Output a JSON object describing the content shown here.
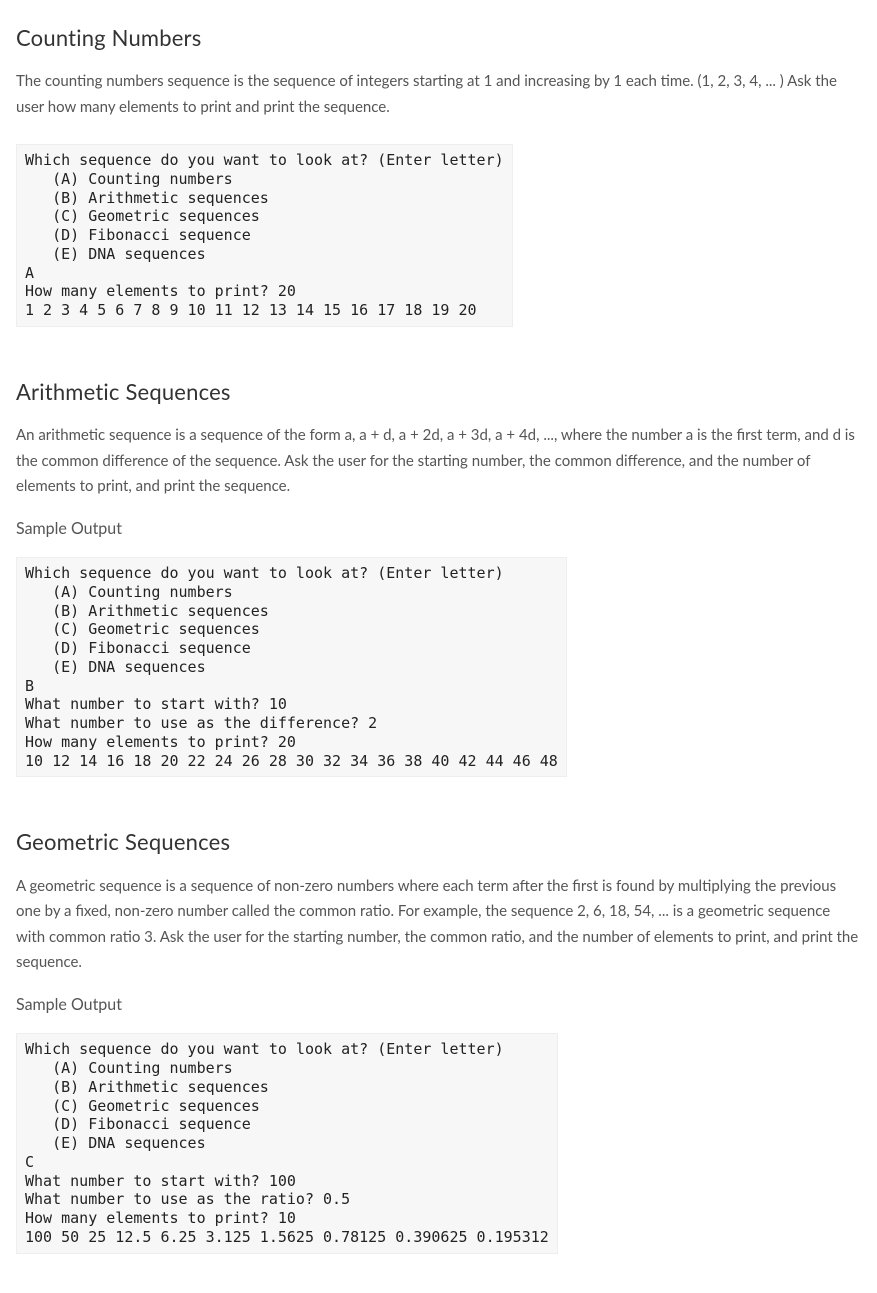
{
  "sections": {
    "counting": {
      "heading": "Counting Numbers",
      "desc": "The counting numbers sequence is the sequence of integers starting at 1 and increasing by 1 each time.  (1, 2, 3, 4, ... ) Ask the user how many elements to print and print the sequence.",
      "code": "Which sequence do you want to look at? (Enter letter)\n   (A) Counting numbers\n   (B) Arithmetic sequences\n   (C) Geometric sequences\n   (D) Fibonacci sequence\n   (E) DNA sequences\nA\nHow many elements to print? 20\n1 2 3 4 5 6 7 8 9 10 11 12 13 14 15 16 17 18 19 20"
    },
    "arithmetic": {
      "heading": "Arithmetic Sequences",
      "desc": "An arithmetic sequence is a sequence of the form a, a + d, a + 2d, a + 3d, a + 4d, ..., where the number a is the first term, and d is the common difference of the sequence. Ask the user for the starting number, the common difference, and the number of elements to print, and print the sequence.",
      "sample_label": "Sample Output",
      "code": "Which sequence do you want to look at? (Enter letter)\n   (A) Counting numbers\n   (B) Arithmetic sequences\n   (C) Geometric sequences\n   (D) Fibonacci sequence\n   (E) DNA sequences\nB\nWhat number to start with? 10\nWhat number to use as the difference? 2\nHow many elements to print? 20\n10 12 14 16 18 20 22 24 26 28 30 32 34 36 38 40 42 44 46 48"
    },
    "geometric": {
      "heading": "Geometric Sequences",
      "desc": "A geometric sequence is a sequence of non-zero numbers where each term after the first is found by multiplying the previous one by a fixed, non-zero number called the common ratio. For example, the sequence 2, 6, 18, 54, ... is a geometric sequence with common ratio 3.  Ask the user for the starting number, the common ratio, and the number of elements to print, and print the sequence.",
      "sample_label": "Sample Output",
      "code": "Which sequence do you want to look at? (Enter letter)\n   (A) Counting numbers\n   (B) Arithmetic sequences\n   (C) Geometric sequences\n   (D) Fibonacci sequence\n   (E) DNA sequences\nC\nWhat number to start with? 100\nWhat number to use as the ratio? 0.5\nHow many elements to print? 10\n100 50 25 12.5 6.25 3.125 1.5625 0.78125 0.390625 0.195312"
    }
  }
}
